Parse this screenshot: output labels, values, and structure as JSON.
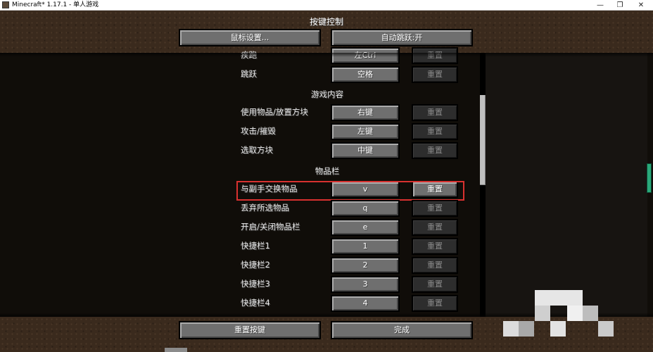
{
  "window": {
    "title": "Minecraft* 1.17.1 - 单人游戏",
    "controls": {
      "minimize": "—",
      "restore": "❐",
      "close": "✕"
    }
  },
  "screen": {
    "title": "按键控制",
    "mouse_settings": "鼠标设置...",
    "auto_jump": "自动跳跃:开"
  },
  "reset_label": "重置",
  "rows": [
    {
      "label": "疾跑",
      "key": "左Ctrl"
    },
    {
      "label": "跳跃",
      "key": "空格"
    }
  ],
  "categories": {
    "gameplay": "游戏内容",
    "inventory": "物品栏"
  },
  "gameplay_rows": [
    {
      "label": "使用物品/放置方块",
      "key": "右键"
    },
    {
      "label": "攻击/摧毁",
      "key": "左键"
    },
    {
      "label": "选取方块",
      "key": "中键"
    }
  ],
  "inventory_rows": [
    {
      "label": "与副手交换物品",
      "key": "v"
    },
    {
      "label": "丢弃所选物品",
      "key": "q"
    },
    {
      "label": "开启/关闭物品栏",
      "key": "e"
    },
    {
      "label": "快捷栏1",
      "key": "1"
    },
    {
      "label": "快捷栏2",
      "key": "2"
    },
    {
      "label": "快捷栏3",
      "key": "3"
    },
    {
      "label": "快捷栏4",
      "key": "4"
    }
  ],
  "footer": {
    "reset_keys": "重置按键",
    "done": "完成"
  },
  "colors": {
    "highlight": "#d8312f",
    "button_face": "#6f6f6f",
    "button_disabled": "#2d2d2d",
    "dirt": "#3a2a1d"
  }
}
